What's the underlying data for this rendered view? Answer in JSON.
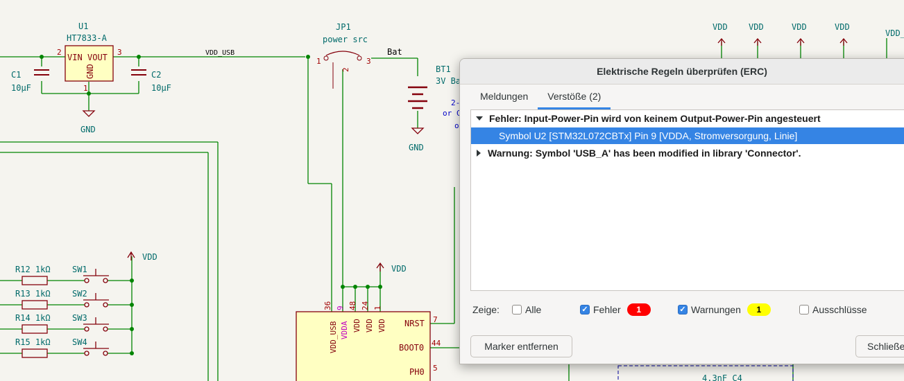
{
  "schematic": {
    "u1_ref": "U1",
    "u1_value": "HT7833-A",
    "u1_vin": "VIN",
    "u1_vout": "VOUT",
    "u1_gnd": "GND",
    "u1_pin2": "2",
    "u1_pin3": "3",
    "u1_pin1": "1",
    "c1_ref": "C1",
    "c1_value": "10µF",
    "c2_ref": "C2",
    "c2_value": "10µF",
    "gnd1": "GND",
    "gnd2": "GND",
    "net_vdd_usb": "VDD_USB",
    "jp1_ref": "JP1",
    "jp1_value": "power src",
    "jp1_pin1": "1",
    "jp1_pin2": "2",
    "jp1_pin3": "3",
    "net_bat": "Bat",
    "bt1_ref": "BT1",
    "bt1_value": "3V Ba",
    "note1": "2-",
    "note2": "or C",
    "note3": "o",
    "vdd_labels": [
      "VDD",
      "VDD",
      "VDD",
      "VDD"
    ],
    "vdd_right": "VDD_",
    "vdd_sw": "VDD",
    "vdd_mcu": "VDD",
    "resistors": [
      {
        "ref": "R12",
        "value": "1kΩ",
        "sw": "SW1"
      },
      {
        "ref": "R13",
        "value": "1kΩ",
        "sw": "SW2"
      },
      {
        "ref": "R14",
        "value": "1kΩ",
        "sw": "SW3"
      },
      {
        "ref": "R15",
        "value": "1kΩ",
        "sw": "SW4"
      }
    ],
    "mcu_pins_top": [
      {
        "num": "36",
        "name": "VDD_USB"
      },
      {
        "num": "9",
        "name": "VDDA"
      },
      {
        "num": "48",
        "name": "VDD"
      },
      {
        "num": "24",
        "name": "VDD"
      },
      {
        "num": "1",
        "name": "VDD"
      }
    ],
    "mcu_nrst": "NRST",
    "mcu_nrst_num": "7",
    "mcu_boot0": "BOOT0",
    "mcu_boot0_num": "44",
    "mcu_ph0": "PH0",
    "mcu_ph0_num": "5",
    "c4_label": "4.3nF C4"
  },
  "dialog": {
    "title": "Elektrische Regeln überprüfen (ERC)",
    "tabs": [
      {
        "label": "Meldungen",
        "active": false
      },
      {
        "label": "Verstöße (2)",
        "active": true
      }
    ],
    "items": [
      {
        "text": "Fehler: Input-Power-Pin wird von keinem Output-Power-Pin angesteuert",
        "level": 0,
        "expanded": true
      },
      {
        "text": "Symbol U2 [STM32L072CBTx] Pin 9 [VDDA, Stromversorgung, Linie]",
        "level": 1,
        "selected": true
      },
      {
        "text": "Warnung: Symbol 'USB_A' has been modified in library 'Connector'.",
        "level": 0,
        "expanded": false
      }
    ],
    "filter": {
      "label": "Zeige:",
      "all": {
        "label": "Alle",
        "checked": false
      },
      "errors": {
        "label": "Fehler",
        "checked": true,
        "count": "1"
      },
      "warnings": {
        "label": "Warnungen",
        "checked": true,
        "count": "1"
      },
      "exclusions": {
        "label": "Ausschlüsse",
        "checked": false
      }
    },
    "buttons": {
      "remove_markers": "Marker entfernen",
      "close": "Schließen"
    }
  },
  "colors": {
    "wire": "#008400",
    "component": "#84000b",
    "component_fill": "#ffffc2",
    "power": "#84000b",
    "selection": "#3584e4",
    "error_badge": "#ff0000",
    "warning_badge": "#ffff00"
  }
}
